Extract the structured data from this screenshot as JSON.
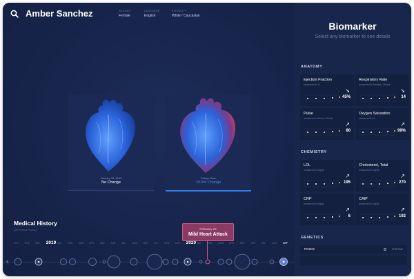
{
  "patient": {
    "name": "Amber Sanchez",
    "gender_label": "GENDER",
    "gender": "Female",
    "language_label": "LANGUAGE",
    "language": "English",
    "ethnicity_label": "ETHNICITY",
    "ethnicity": "White / Caucasian"
  },
  "scans": [
    {
      "date": "January 16, 2019",
      "status": "No Change"
    },
    {
      "date": "Todays Scan",
      "status": "15.5% Change"
    }
  ],
  "history": {
    "title": "Medical History",
    "subtitle": "(36 Events Found)",
    "months": [
      "OCT",
      "NOV",
      "DEC",
      "2019",
      "JAN",
      "FEB",
      "MAR",
      "APR",
      "MAY",
      "JUN",
      "JUL",
      "AUG",
      "SEP",
      "OCT",
      "NOV",
      "DEC",
      "2020",
      "JAN",
      "FEB",
      "MAR",
      "APR",
      "MAY",
      "JUN",
      "JUL",
      "AUG",
      "SEP"
    ],
    "tooltip_date": "February 23",
    "tooltip_event": "Mild Heart Attack"
  },
  "sidebar": {
    "title": "Biomarker",
    "subtitle": "Select any biomarker to see details",
    "sections": {
      "anatomy": "ANATOMY",
      "chemistry": "CHEMISTRY",
      "genetics": "GENETICS"
    },
    "biomarkers": [
      {
        "name": "Ejection Fraction",
        "unit": "measured in %",
        "value": "45%",
        "arrow": "↘"
      },
      {
        "name": "Respiratory Rate",
        "unit": "measured in Breaths / Minute",
        "value": "14",
        "arrow": "↘"
      },
      {
        "name": "Pulse",
        "unit": "measured in Beats / Minute",
        "value": "80",
        "arrow": "↗"
      },
      {
        "name": "Oxygen Saturation",
        "unit": "measured in %",
        "value": "99%",
        "arrow": "↗"
      },
      {
        "name": "LDL",
        "unit": "measured in mg/dL",
        "value": "195",
        "arrow": "↗"
      },
      {
        "name": "Cholesterol, Total",
        "unit": "measured in mg/dL",
        "value": "270",
        "arrow": "↗"
      },
      {
        "name": "CRP",
        "unit": "measured in mg/dL",
        "value": "6",
        "arrow": "↗"
      },
      {
        "name": "CAIP",
        "unit": "measured in mg/dL",
        "value": "192",
        "arrow": "↗"
      }
    ],
    "genetics": [
      {
        "name": "PCSK9",
        "status": "POSITIVE"
      }
    ]
  },
  "colors": {
    "background": "#172549",
    "accent_blue": "#2f7ff0",
    "event_pink": "#c25a8a",
    "normal_heart": "#2d6be0",
    "changed_heart_edge": "#d0455e"
  }
}
